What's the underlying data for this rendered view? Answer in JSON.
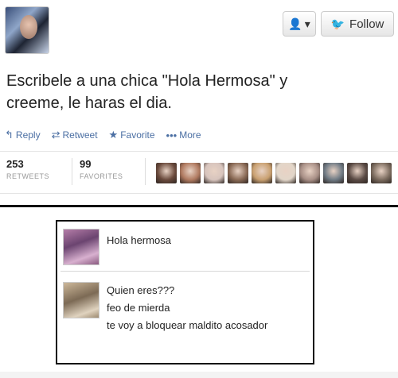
{
  "header": {
    "user_menu_icon": "person-icon",
    "user_menu_caret": "▾",
    "follow_label": "Follow",
    "follow_icon": "twitter-bird-icon"
  },
  "tweet": {
    "text_line1": "Escribele a una chica \"Hola Hermosa\" y",
    "text_line2": "creeme, le haras el dia."
  },
  "actions": {
    "reply": "Reply",
    "retweet": "Retweet",
    "favorite": "Favorite",
    "more": "More"
  },
  "stats": {
    "retweets_count": "253",
    "retweets_label": "RETWEETS",
    "favorites_count": "99",
    "favorites_label": "FAVORITES",
    "face_colors": [
      "#6a4a3c",
      "#b07a60",
      "#d7c4bd",
      "#8a6a55",
      "#c9a070",
      "#e2d6c9",
      "#a88f86",
      "#6f7a84",
      "#5a4a44",
      "#7b6b5e"
    ]
  },
  "chat": {
    "message1": {
      "lines": [
        "Hola hermosa"
      ]
    },
    "message2": {
      "lines": [
        "Quien eres???",
        "feo de mierda",
        "te voy a bloquear maldito acosador"
      ]
    }
  }
}
